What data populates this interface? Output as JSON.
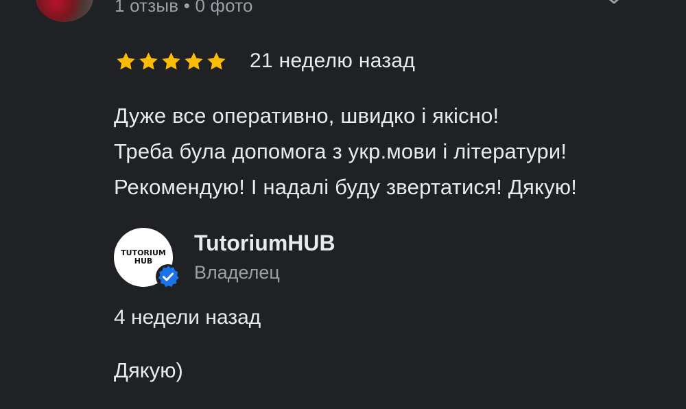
{
  "reviewer": {
    "meta": "1 отзыв • 0 фото"
  },
  "review": {
    "rating": 5,
    "rating_max": 5,
    "date": "21 неделю назад",
    "lines": [
      "Дуже все оперативно, швидко і якісно!",
      "Треба була допомога з укр.мови і літератури!",
      "Рекомендую! І надалі буду звертатися! Дякую!"
    ]
  },
  "owner": {
    "logo_line1": "TUTORIUM",
    "logo_line2": "HUB",
    "name": "TutoriumHUB",
    "role": "Владелец",
    "reply_date": "4 недели назад",
    "reply_text": "Дякую)"
  },
  "colors": {
    "background": "#202124",
    "text_primary": "#e8eaed",
    "text_secondary": "#9aa0a6",
    "star": "#fbbc04",
    "verified": "#1a73e8"
  },
  "icons": {
    "more": "more-options-icon",
    "star": "star-icon",
    "verified": "verified-check-icon"
  }
}
